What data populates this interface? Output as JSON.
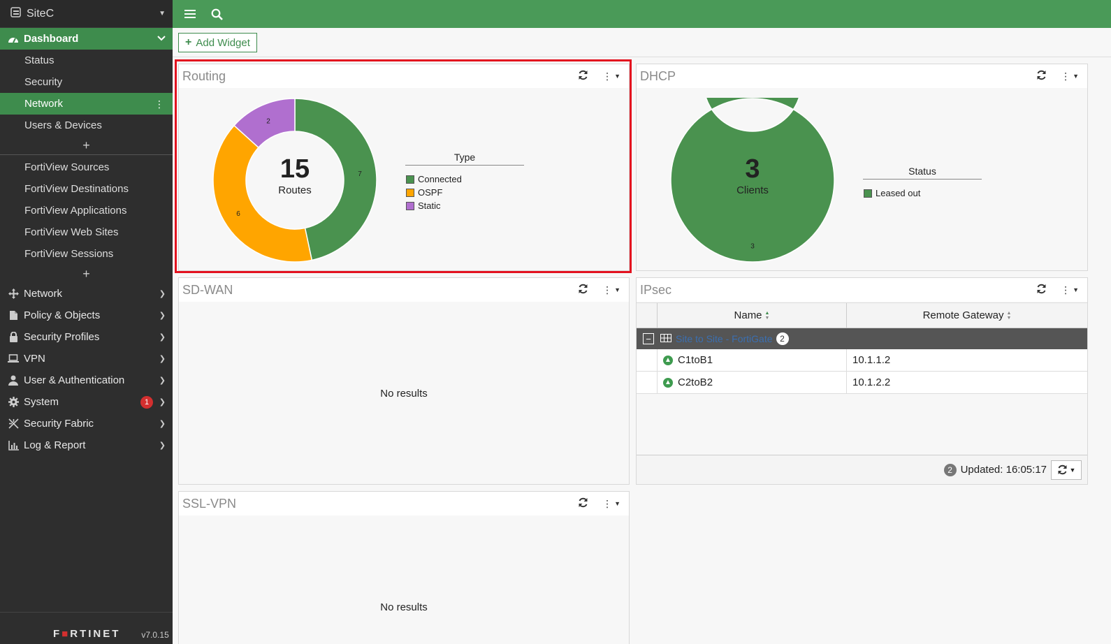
{
  "site": {
    "name": "SiteC"
  },
  "sidebar": {
    "dashboard": {
      "label": "Dashboard",
      "items": [
        {
          "label": "Status"
        },
        {
          "label": "Security"
        },
        {
          "label": "Network"
        },
        {
          "label": "Users & Devices"
        }
      ],
      "fortiview": [
        {
          "label": "FortiView Sources"
        },
        {
          "label": "FortiView Destinations"
        },
        {
          "label": "FortiView Applications"
        },
        {
          "label": "FortiView Web Sites"
        },
        {
          "label": "FortiView Sessions"
        }
      ]
    },
    "menus": [
      {
        "label": "Network",
        "icon": "move-arrows-icon"
      },
      {
        "label": "Policy & Objects",
        "icon": "policy-icon"
      },
      {
        "label": "Security Profiles",
        "icon": "lock-icon"
      },
      {
        "label": "VPN",
        "icon": "laptop-icon"
      },
      {
        "label": "User & Authentication",
        "icon": "user-icon"
      },
      {
        "label": "System",
        "icon": "gear-icon",
        "badge": "1"
      },
      {
        "label": "Security Fabric",
        "icon": "fabric-icon"
      },
      {
        "label": "Log & Report",
        "icon": "chart-icon"
      }
    ],
    "footer": {
      "brand": "FORTINET",
      "version": "v7.0.15"
    }
  },
  "toolbar": {
    "add_widget_label": "Add Widget"
  },
  "widgets": {
    "routing": {
      "title": "Routing",
      "center_value": "15",
      "center_label": "Routes",
      "legend_title": "Type",
      "chart_data": {
        "type": "pie",
        "total": 15,
        "slices": [
          {
            "label": "Connected",
            "value": 7,
            "color": "#4a924f"
          },
          {
            "label": "OSPF",
            "value": 6,
            "color": "#ffa500"
          },
          {
            "label": "Static",
            "value": 2,
            "color": "#b06fcf"
          }
        ]
      }
    },
    "dhcp": {
      "title": "DHCP",
      "center_value": "3",
      "center_label": "Clients",
      "legend_title": "Status",
      "chart_data": {
        "type": "pie",
        "total": 3,
        "slices": [
          {
            "label": "Leased out",
            "value": 3,
            "color": "#4a924f"
          }
        ]
      }
    },
    "sdwan": {
      "title": "SD-WAN",
      "empty_text": "No results"
    },
    "sslvpn": {
      "title": "SSL-VPN",
      "empty_text": "No results"
    },
    "ipsec": {
      "title": "IPsec",
      "columns": [
        "Name",
        "Remote Gateway"
      ],
      "group": {
        "name": "Site to Site - FortiGate",
        "count": "2"
      },
      "rows": [
        {
          "name": "C1toB1",
          "gateway": "10.1.1.2"
        },
        {
          "name": "C2toB2",
          "gateway": "10.1.2.2"
        }
      ],
      "footer": {
        "count": "2",
        "updated": "Updated: 16:05:17"
      }
    }
  }
}
